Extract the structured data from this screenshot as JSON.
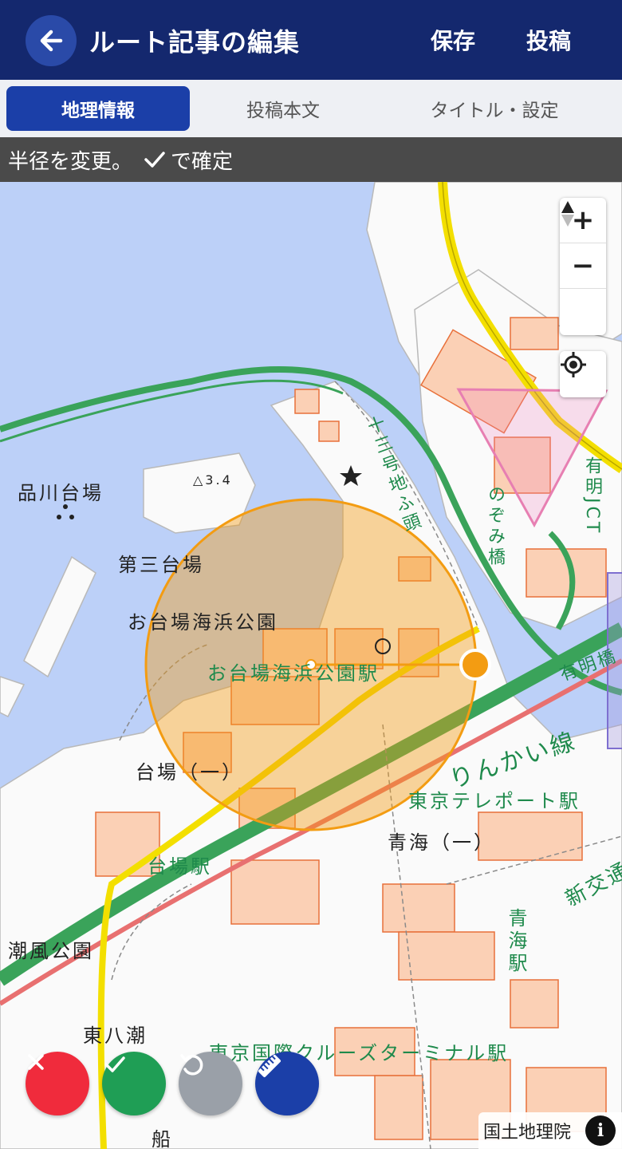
{
  "header": {
    "title": "ルート記事の編集",
    "save_label": "保存",
    "post_label": "投稿",
    "back_icon": "arrow-left-icon",
    "bg_color": "#14286e"
  },
  "tabs": [
    {
      "label": "地理情報",
      "active": true
    },
    {
      "label": "投稿本文",
      "active": false
    },
    {
      "label": "タイトル・設定",
      "active": false
    }
  ],
  "status": {
    "text_before": "半径を変更。",
    "text_after": "で確定",
    "icon": "check-icon"
  },
  "map": {
    "controls": {
      "zoom_in": "+",
      "zoom_out": "−",
      "compass_icon": "compass-icon",
      "locate_icon": "crosshair-icon"
    },
    "labels": {
      "shinagawa": "品川台場",
      "daisan": "第三台場",
      "kaihin_park": "お台場海浜公園",
      "kaihin_station": "お台場海浜公園駅",
      "daiba1": "台場（一）",
      "daiba_station": "台場駅",
      "shiokaze": "潮風公園",
      "higashi_yashio": "東八潮",
      "teleport": "東京テレポート駅",
      "aomi1": "青海（一）",
      "aomi_station": "青海駅",
      "cruise": "東京国際クルーズターミナル駅",
      "rinkai": "りんかい線",
      "ariake_bridge": "有明橋",
      "shinkotsu": "新交通",
      "jusan": "十三号地ふ頭",
      "nozomi": "のぞみ橋",
      "ariake_jct": "有明JCT",
      "elev": "△3.4",
      "ship": "船"
    },
    "circle_color": "#f39c12"
  },
  "fabs": {
    "cancel_icon": "close-icon",
    "confirm_icon": "check-icon",
    "undo_icon": "undo-icon",
    "measure_icon": "ruler-icon"
  },
  "attribution": {
    "text": "国土地理院",
    "info": "i"
  }
}
